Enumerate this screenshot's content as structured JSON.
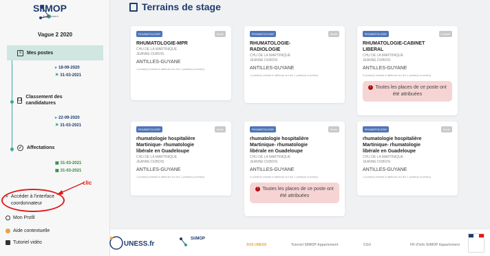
{
  "brand": {
    "name": "SiiMOP",
    "subtitle": "Appariement"
  },
  "sidebar": {
    "vague": "Vague 2 2020",
    "steps": [
      {
        "label": "Mes postes",
        "dates": [
          "18-09-2020",
          "31-03-2021"
        ]
      },
      {
        "label": "Classement des candidatures",
        "dates": [
          "22-09-2020",
          "31-03-2021"
        ]
      },
      {
        "label": "Affectations",
        "dates": [
          "31-03-2021",
          "31-03-2021"
        ]
      }
    ],
    "bottom": {
      "coord": "Accéder à l'interface coordonnateur",
      "profil": "Mon Profil",
      "aide": "Aide contextuelle",
      "tuto": "Tutoriel vidéo"
    }
  },
  "annotation": {
    "label": "clic",
    "color": "#e01b1b"
  },
  "main": {
    "title": "Terrains de stage",
    "cards": [
      {
        "tag": "RHUMATOLOGIE",
        "mode": "Mode",
        "title": "RHUMATOLOGIE-MPR",
        "hospital": "CHU DE LA MARTINIQUE",
        "person": "JEANNE DUBOIS",
        "region": "ANTILLES-GUYANE",
        "note": "1 poste(s) restant à attribuer sur les 1 poste(s) ouvert(s)",
        "full": ""
      },
      {
        "tag": "RHUMATOLOGIE",
        "mode": "Mode",
        "title": "RHUMATOLOGIE-RADIOLOGIE",
        "hospital": "CHU DE LA MARTINIQUE",
        "person": "JEANNE DUBOIS",
        "region": "ANTILLES-GUYANE",
        "note": "1 poste(s) restant à attribuer sur les 1 poste(s) ouvert(s)",
        "full": ""
      },
      {
        "tag": "RHUMATOLOGIE",
        "mode": "Conseil",
        "title": "RHUMATOLOGIE-CABINET LIBERAL",
        "hospital": "CHU DE LA MARTINIQUE",
        "person": "JEANNE DUBOIS",
        "region": "ANTILLES-GUYANE",
        "note": "0 poste(s) restant à attribuer sur les 1 poste(s) ouvert(s)",
        "full": "Toutes les places de ce poste ont été attribuées"
      },
      {
        "tag": "RHUMATOLOGIE",
        "mode": "Mode",
        "title": "rhumatologie hospitalière Martinique- rhumatologie libérale en Guadeloupe",
        "hospital": "CHU DE LA MARTINIQUE",
        "person": "JEANNE DUBOIS",
        "region": "ANTILLES-GUYANE",
        "note": "1 poste(s) restant à attribuer sur les 1 poste(s) ouvert(s)",
        "full": ""
      },
      {
        "tag": "RHUMATOLOGIE",
        "mode": "Mode",
        "title": "rhumatologie hospitalière Martinique- rhumatologie libérale en Guadeloupe",
        "hospital": "CHU DE LA MARTINIQUE",
        "person": "JEANNE DUBOIS",
        "region": "ANTILLES-GUYANE",
        "note": "0 poste(s) restant à attribuer sur les 1 poste(s) ouvert(s)",
        "full": "Toutes les places de ce poste ont été attribuées"
      },
      {
        "tag": "RHUMATOLOGIE",
        "mode": "Mode",
        "title": "rhumatologie hospitalière Martinique- rhumatologie libérale en Guadeloupe",
        "hospital": "CHU DE LA MARTINIQUE",
        "person": "JEANNE DUBOIS",
        "region": "ANTILLES-GUYANE",
        "note": "1 poste(s) restant à attribuer sur les 1 poste(s) ouvert(s)",
        "full": ""
      }
    ]
  },
  "footer": {
    "uness": "UNESS.fr",
    "siimop": "SiiMOP",
    "links": [
      "SOS UNESS",
      "Tutoriel SIIMOP Appariement",
      "CGU",
      "FR d'Info SiiMOP Appariement"
    ]
  },
  "colors": {
    "primary": "#1d3b6e",
    "accent": "#3aa796",
    "tag": "#4e76b8",
    "alert": "#f6d4d4",
    "orange": "#e8a33b"
  }
}
